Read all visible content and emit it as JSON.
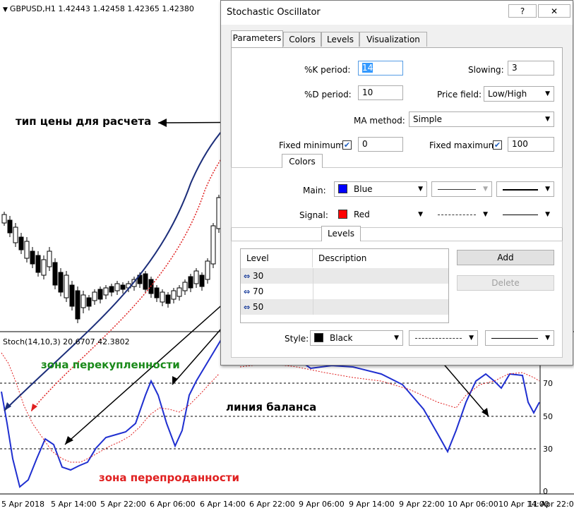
{
  "chart": {
    "header": "GBPUSD,H1  1.42443 1.42458 1.42365 1.42380",
    "stoch_label": "Stoch(14,10,3) 20.6707 42.3802",
    "x_labels": [
      "5 Apr 2018",
      "5 Apr 14:00",
      "5 Apr 22:00",
      "6 Apr 06:00",
      "6 Apr 14:00",
      "6 Apr 22:00",
      "9 Apr 06:00",
      "9 Apr 14:00",
      "9 Apr 22:00",
      "10 Apr 06:00",
      "10 Apr 14:00",
      "11 Apr 22:00"
    ],
    "y_labels": [
      "70",
      "50",
      "30",
      "0"
    ]
  },
  "annotations": {
    "price_type": "тип цены для расчета",
    "overbought": "зона перекупленности",
    "balance": "линия баланса",
    "oversold": "зона перепроданности",
    "colors": {
      "price_type": "#000000",
      "overbought": "#1a8a1a",
      "balance": "#000000",
      "oversold": "#e02020"
    }
  },
  "dialog": {
    "title": "Stochastic Oscillator",
    "help_button": "?",
    "minimize_button": "–",
    "close_button": "✕",
    "tabs": [
      "Parameters",
      "Colors",
      "Levels",
      "Visualization"
    ],
    "params": {
      "k_period_label": "%K period:",
      "k_period_value": "14",
      "slowing_label": "Slowing:",
      "slowing_value": "3",
      "d_period_label": "%D period:",
      "d_period_value": "10",
      "price_field_label": "Price field:",
      "price_field_value": "Low/High",
      "ma_method_label": "MA method:",
      "ma_method_value": "Simple",
      "fixed_min_label": "Fixed minimum",
      "fixed_min_value": "0",
      "fixed_max_label": "Fixed maximum",
      "fixed_max_value": "100"
    },
    "colors_section": {
      "title": "Colors",
      "main_label": "Main:",
      "main_color_name": "Blue",
      "main_color": "#0000ff",
      "signal_label": "Signal:",
      "signal_color_name": "Red",
      "signal_color": "#ff0000"
    },
    "levels_section": {
      "title": "Levels",
      "columns": [
        "Level",
        "Description"
      ],
      "rows": [
        {
          "level": "30",
          "description": ""
        },
        {
          "level": "70",
          "description": ""
        },
        {
          "level": "50",
          "description": ""
        }
      ],
      "add_button": "Add",
      "delete_button": "Delete",
      "style_label": "Style:",
      "style_color_name": "Black",
      "style_color": "#000000"
    }
  }
}
